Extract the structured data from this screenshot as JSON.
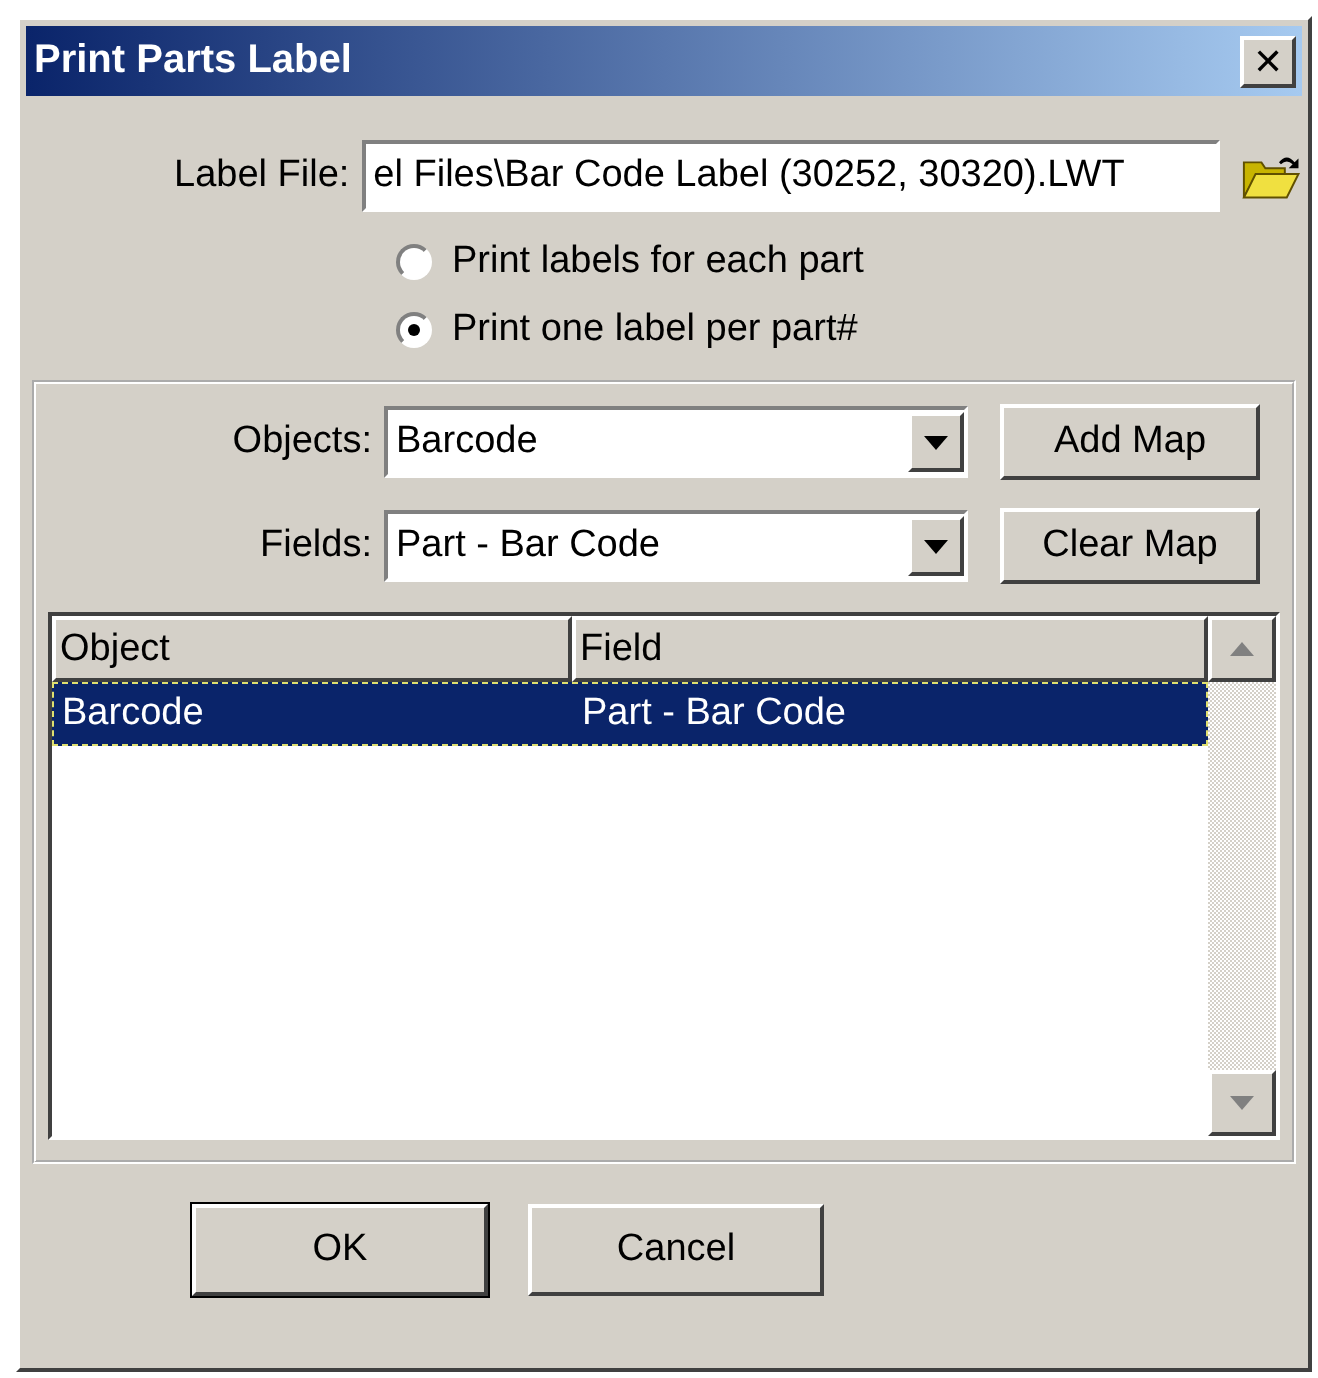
{
  "window": {
    "title": "Print Parts Label",
    "close": "✕"
  },
  "label_file": {
    "label": "Label File:",
    "value": "el Files\\Bar Code Label (30252, 30320).LWT"
  },
  "print_mode": [
    {
      "label": "Print labels for each part",
      "selected": false
    },
    {
      "label": "Print one label per part#",
      "selected": true
    }
  ],
  "objects": {
    "label": "Objects:",
    "value": "Barcode"
  },
  "fields": {
    "label": "Fields:",
    "value": "Part - Bar Code"
  },
  "map_buttons": [
    "Add Map",
    "Clear Map"
  ],
  "table": {
    "columns": [
      "Object",
      "Field"
    ],
    "rows": [
      {
        "cells": [
          "Barcode",
          "Part - Bar Code"
        ],
        "selected": true
      }
    ]
  },
  "buttons": [
    {
      "label": "OK",
      "default": true
    },
    {
      "label": "Cancel",
      "default": false
    }
  ]
}
